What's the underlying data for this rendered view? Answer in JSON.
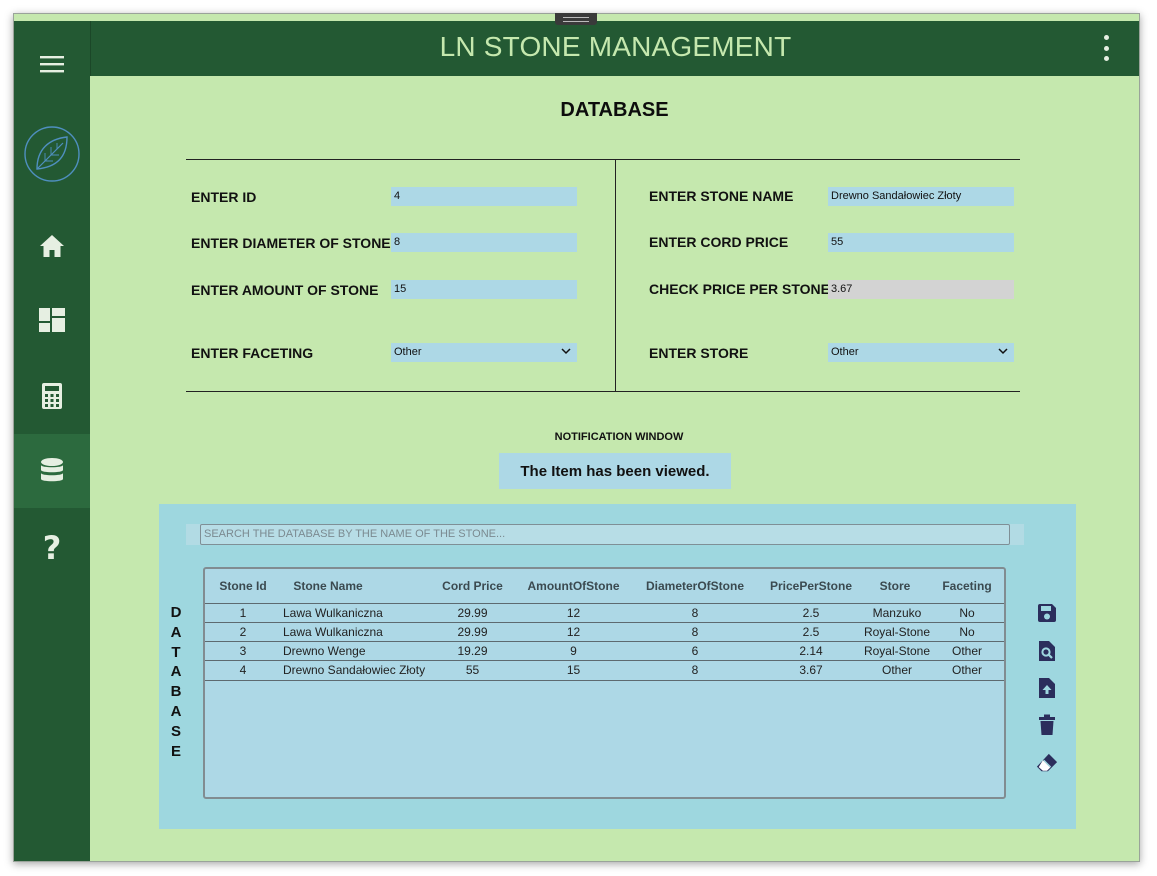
{
  "app": {
    "title": "LN STONE MANAGEMENT"
  },
  "page": {
    "title": "DATABASE"
  },
  "sidebar": {
    "items": [
      {
        "icon": "menu-icon"
      },
      {
        "icon": "leaf-logo-icon"
      },
      {
        "icon": "home-icon"
      },
      {
        "icon": "dashboard-icon"
      },
      {
        "icon": "calculator-icon"
      },
      {
        "icon": "database-icon",
        "active": true
      },
      {
        "icon": "help-icon",
        "glyph": "?"
      }
    ]
  },
  "form": {
    "id_label": "ENTER ID",
    "id_value": "4",
    "diameter_label": "ENTER DIAMETER OF STONE",
    "diameter_value": "8",
    "amount_label": "ENTER AMOUNT OF STONE",
    "amount_value": "15",
    "faceting_label": "ENTER FACETING",
    "faceting_value": "Other",
    "name_label": "ENTER STONE NAME",
    "name_value": "Drewno Sandałowiec Złoty",
    "cord_label": "ENTER CORD PRICE",
    "cord_value": "55",
    "price_label": "CHECK PRICE PER STONE",
    "price_value": "3.67",
    "store_label": "ENTER STORE",
    "store_value": "Other"
  },
  "notification": {
    "title": "NOTIFICATION WINDOW",
    "message": "The Item has been viewed."
  },
  "database": {
    "side_label": "DATABASE",
    "search_placeholder": "SEARCH THE DATABASE BY THE NAME OF THE STONE...",
    "columns": [
      "Stone Id",
      "Stone Name",
      "Cord Price",
      "AmountOfStone",
      "DiameterOfStone",
      "PricePerStone",
      "Store",
      "Faceting"
    ],
    "rows": [
      [
        "1",
        "Lawa Wulkaniczna",
        "29.99",
        "12",
        "8",
        "2.5",
        "Manzuko",
        "No"
      ],
      [
        "2",
        "Lawa Wulkaniczna",
        "29.99",
        "12",
        "8",
        "2.5",
        "Royal-Stone",
        "No"
      ],
      [
        "3",
        "Drewno Wenge",
        "19.29",
        "9",
        "6",
        "2.14",
        "Royal-Stone",
        "Other"
      ],
      [
        "4",
        "Drewno Sandałowiec Złoty",
        "55",
        "15",
        "8",
        "3.67",
        "Other",
        "Other"
      ]
    ],
    "actions": [
      "save-icon",
      "view-icon",
      "update-icon",
      "delete-icon",
      "clear-icon"
    ]
  },
  "colors": {
    "sidebar": "#235933",
    "background": "#c5e8ae",
    "panel": "#9ed7df",
    "input": "#add8e6",
    "icon_navy": "#2b2e5c"
  }
}
